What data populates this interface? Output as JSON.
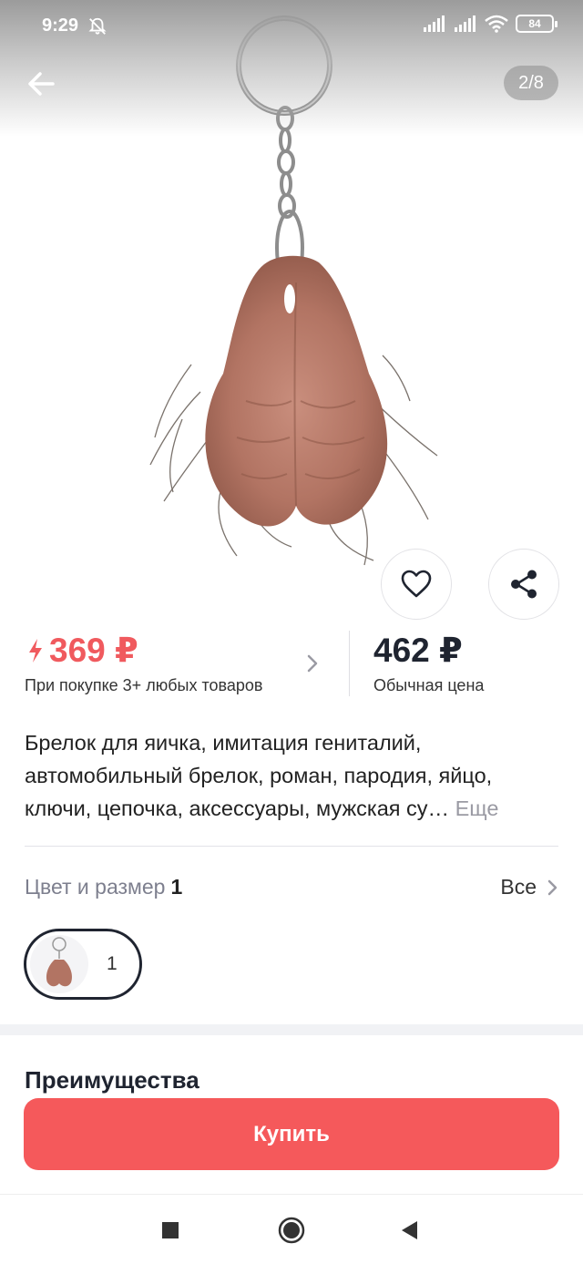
{
  "status_bar": {
    "time": "9:29",
    "battery": "84",
    "icons": [
      "bell-off-icon",
      "signal-icon",
      "signal-icon",
      "wifi-icon",
      "battery-icon"
    ]
  },
  "gallery": {
    "page_counter": "2/8",
    "current_index": 2,
    "total": 8
  },
  "price": {
    "sale_price": "369 ₽",
    "sale_note": "При покупке 3+ любых товаров",
    "regular_price": "462 ₽",
    "regular_note": "Обычная цена",
    "accent_color": "#f05a5e"
  },
  "product": {
    "title_lines": [
      "Брелок для яичка, имитация гениталий,",
      "автомобильный брелок, роман, пародия, яйцо,",
      "ключи, цепочка, аксессуары, мужская су…"
    ],
    "more_label": "Еще"
  },
  "variants": {
    "label": "Цвет и размер",
    "count": "1",
    "all_label": "Все",
    "selected_chip": "1"
  },
  "sections": {
    "advantages_title": "Преимущества"
  },
  "buy_button": {
    "label": "Купить",
    "color": "#f5595b"
  },
  "nav": {
    "icons": [
      "recent-apps-icon",
      "home-icon",
      "back-triangle-icon"
    ]
  }
}
